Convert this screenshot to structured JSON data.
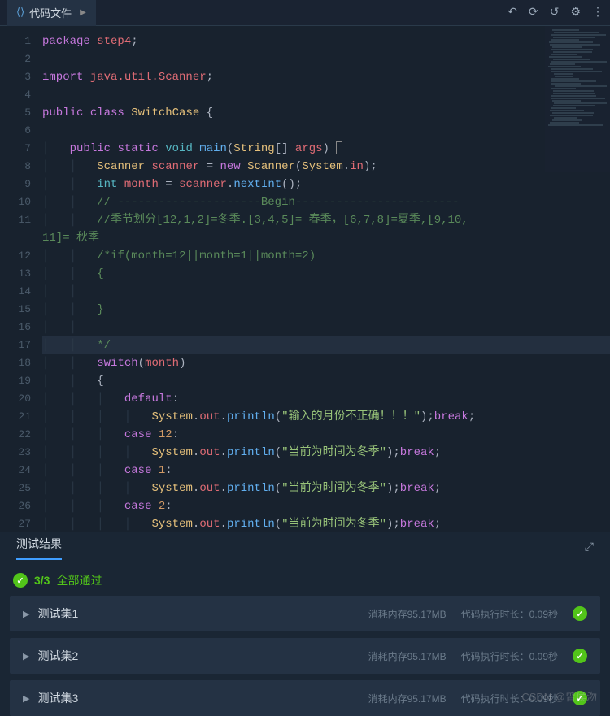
{
  "tab": {
    "label": "代码文件"
  },
  "code": {
    "lines": [
      {
        "n": 1,
        "segs": [
          {
            "t": "package ",
            "c": "kw"
          },
          {
            "t": "step4",
            "c": "var"
          },
          {
            "t": ";",
            "c": "op"
          }
        ]
      },
      {
        "n": 2,
        "segs": []
      },
      {
        "n": 3,
        "segs": [
          {
            "t": "import ",
            "c": "kw"
          },
          {
            "t": "java.util.Scanner",
            "c": "var"
          },
          {
            "t": ";",
            "c": "op"
          }
        ]
      },
      {
        "n": 4,
        "segs": []
      },
      {
        "n": 5,
        "segs": [
          {
            "t": "public ",
            "c": "kw"
          },
          {
            "t": "class ",
            "c": "kw"
          },
          {
            "t": "SwitchCase ",
            "c": "cls"
          },
          {
            "t": "{",
            "c": "op"
          }
        ]
      },
      {
        "n": 6,
        "segs": []
      },
      {
        "n": 7,
        "indent": 1,
        "segs": [
          {
            "t": "public ",
            "c": "kw"
          },
          {
            "t": "static ",
            "c": "kw"
          },
          {
            "t": "void ",
            "c": "type"
          },
          {
            "t": "main",
            "c": "fn"
          },
          {
            "t": "(",
            "c": "op"
          },
          {
            "t": "String",
            "c": "cls"
          },
          {
            "t": "[] ",
            "c": "op"
          },
          {
            "t": "args",
            "c": "var"
          },
          {
            "t": ") ",
            "c": "op"
          },
          {
            "t": "{",
            "c": "op",
            "box": true
          }
        ]
      },
      {
        "n": 8,
        "indent": 2,
        "segs": [
          {
            "t": "Scanner ",
            "c": "cls"
          },
          {
            "t": "scanner ",
            "c": "var"
          },
          {
            "t": "= ",
            "c": "op"
          },
          {
            "t": "new ",
            "c": "kw"
          },
          {
            "t": "Scanner",
            "c": "cls"
          },
          {
            "t": "(",
            "c": "op"
          },
          {
            "t": "System",
            "c": "cls"
          },
          {
            "t": ".",
            "c": "op"
          },
          {
            "t": "in",
            "c": "var"
          },
          {
            "t": ");",
            "c": "op"
          }
        ]
      },
      {
        "n": 9,
        "indent": 2,
        "segs": [
          {
            "t": "int ",
            "c": "type"
          },
          {
            "t": "month ",
            "c": "var"
          },
          {
            "t": "= ",
            "c": "op"
          },
          {
            "t": "scanner",
            "c": "var"
          },
          {
            "t": ".",
            "c": "op"
          },
          {
            "t": "nextInt",
            "c": "fn"
          },
          {
            "t": "();",
            "c": "op"
          }
        ]
      },
      {
        "n": 10,
        "indent": 2,
        "segs": [
          {
            "t": "// ---------------------Begin------------------------",
            "c": "cmt-g"
          }
        ]
      },
      {
        "n": 11,
        "indent": 2,
        "segs": [
          {
            "t": "//季节划分[12,1,2]=冬季.[3,4,5]= 春季，[6,7,8]=夏季,[9,10,",
            "c": "cmt-g"
          }
        ],
        "wrap": "11]= 秋季"
      },
      {
        "n": 12,
        "indent": 2,
        "segs": [
          {
            "t": "/*if(month=12||month=1||month=2)",
            "c": "cmt-g"
          }
        ]
      },
      {
        "n": 13,
        "indent": 2,
        "segs": [
          {
            "t": "{",
            "c": "cmt-g"
          }
        ]
      },
      {
        "n": 14,
        "indent": 2,
        "segs": []
      },
      {
        "n": 15,
        "indent": 2,
        "segs": [
          {
            "t": "}",
            "c": "cmt-g"
          }
        ]
      },
      {
        "n": 16,
        "indent": 2,
        "segs": []
      },
      {
        "n": 17,
        "indent": 2,
        "current": true,
        "segs": [
          {
            "t": "*/",
            "c": "cmt-g"
          },
          {
            "t": "",
            "c": "op",
            "cursor": true
          }
        ]
      },
      {
        "n": 18,
        "indent": 2,
        "segs": [
          {
            "t": "switch",
            "c": "kw"
          },
          {
            "t": "(",
            "c": "op"
          },
          {
            "t": "month",
            "c": "var"
          },
          {
            "t": ")",
            "c": "op"
          }
        ]
      },
      {
        "n": 19,
        "indent": 2,
        "segs": [
          {
            "t": "{",
            "c": "op"
          }
        ]
      },
      {
        "n": 20,
        "indent": 3,
        "segs": [
          {
            "t": "default",
            "c": "kw"
          },
          {
            "t": ":",
            "c": "op"
          }
        ]
      },
      {
        "n": 21,
        "indent": 4,
        "segs": [
          {
            "t": "System",
            "c": "cls"
          },
          {
            "t": ".",
            "c": "op"
          },
          {
            "t": "out",
            "c": "var"
          },
          {
            "t": ".",
            "c": "op"
          },
          {
            "t": "println",
            "c": "fn"
          },
          {
            "t": "(",
            "c": "op"
          },
          {
            "t": "\"输入的月份不正确！！！\"",
            "c": "str"
          },
          {
            "t": ");",
            "c": "op"
          },
          {
            "t": "break",
            "c": "kw"
          },
          {
            "t": ";",
            "c": "op"
          }
        ]
      },
      {
        "n": 22,
        "indent": 3,
        "segs": [
          {
            "t": "case ",
            "c": "kw"
          },
          {
            "t": "12",
            "c": "num"
          },
          {
            "t": ":",
            "c": "op"
          }
        ]
      },
      {
        "n": 23,
        "indent": 4,
        "segs": [
          {
            "t": "System",
            "c": "cls"
          },
          {
            "t": ".",
            "c": "op"
          },
          {
            "t": "out",
            "c": "var"
          },
          {
            "t": ".",
            "c": "op"
          },
          {
            "t": "println",
            "c": "fn"
          },
          {
            "t": "(",
            "c": "op"
          },
          {
            "t": "\"当前为时间为冬季\"",
            "c": "str"
          },
          {
            "t": ");",
            "c": "op"
          },
          {
            "t": "break",
            "c": "kw"
          },
          {
            "t": ";",
            "c": "op"
          }
        ]
      },
      {
        "n": 24,
        "indent": 3,
        "segs": [
          {
            "t": "case ",
            "c": "kw"
          },
          {
            "t": "1",
            "c": "num"
          },
          {
            "t": ":",
            "c": "op"
          }
        ]
      },
      {
        "n": 25,
        "indent": 4,
        "segs": [
          {
            "t": "System",
            "c": "cls"
          },
          {
            "t": ".",
            "c": "op"
          },
          {
            "t": "out",
            "c": "var"
          },
          {
            "t": ".",
            "c": "op"
          },
          {
            "t": "println",
            "c": "fn"
          },
          {
            "t": "(",
            "c": "op"
          },
          {
            "t": "\"当前为时间为冬季\"",
            "c": "str"
          },
          {
            "t": ");",
            "c": "op"
          },
          {
            "t": "break",
            "c": "kw"
          },
          {
            "t": ";",
            "c": "op"
          }
        ]
      },
      {
        "n": 26,
        "indent": 3,
        "segs": [
          {
            "t": "case ",
            "c": "kw"
          },
          {
            "t": "2",
            "c": "num"
          },
          {
            "t": ":",
            "c": "op"
          }
        ]
      },
      {
        "n": 27,
        "indent": 4,
        "segs": [
          {
            "t": "System",
            "c": "cls"
          },
          {
            "t": ".",
            "c": "op"
          },
          {
            "t": "out",
            "c": "var"
          },
          {
            "t": ".",
            "c": "op"
          },
          {
            "t": "println",
            "c": "fn"
          },
          {
            "t": "(",
            "c": "op"
          },
          {
            "t": "\"当前为时间为冬季\"",
            "c": "str"
          },
          {
            "t": ");",
            "c": "op"
          },
          {
            "t": "break",
            "c": "kw"
          },
          {
            "t": ";",
            "c": "op"
          }
        ]
      }
    ]
  },
  "results": {
    "tab_label": "测试结果",
    "pass_count": "3/3",
    "pass_text": "全部通过",
    "tests": [
      {
        "name": "测试集1",
        "memory": "消耗内存95.17MB",
        "time": "代码执行时长：0.09秒"
      },
      {
        "name": "测试集2",
        "memory": "消耗内存95.17MB",
        "time": "代码执行时长：0.09秒"
      },
      {
        "name": "测试集3",
        "memory": "消耗内存95.17MB",
        "time": "代码执行时长：0.09秒"
      }
    ]
  },
  "watermark": "CSDN @曾侯沕"
}
